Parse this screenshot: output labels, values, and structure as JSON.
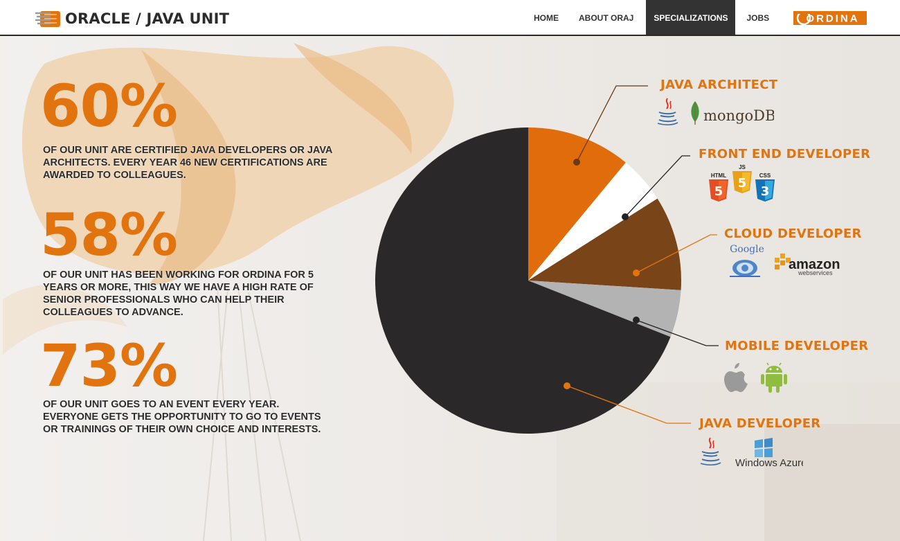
{
  "header": {
    "brand_title": "ORACLE / JAVA UNIT",
    "nav": [
      {
        "label": "HOME",
        "active": false
      },
      {
        "label": "ABOUT ORAJ",
        "active": false
      },
      {
        "label": "SPECIALIZATIONS",
        "active": true
      },
      {
        "label": "JOBS",
        "active": false
      }
    ],
    "partner_logo_text": "ORDINA"
  },
  "stats": [
    {
      "number": "60%",
      "text": "OF OUR UNIT ARE CERTIFIED JAVA DEVELOPERS OR JAVA ARCHITECTS. EVERY YEAR 46 NEW  CERTIFICATIONS ARE AWARDED TO COLLEAGUES."
    },
    {
      "number": "58%",
      "text": "OF OUR UNIT HAS BEEN WORKING FOR ORDINA FOR 5 YEARS OR MORE, THIS WAY WE HAVE A HIGH RATE OF SENIOR PROFESSIONALS WHO CAN HELP THEIR COLLEAGUES TO ADVANCE."
    },
    {
      "number": "73%",
      "text": "OF OUR UNIT GOES TO AN EVENT EVERY YEAR. EVERYONE GETS THE OPPORTUNITY TO GO TO EVENTS OR TRAININGS OF THEIR OWN CHOICE AND INTERESTS."
    }
  ],
  "roles": [
    {
      "title": "JAVA ARCHITECT",
      "tech": [
        "java-icon",
        "mongodb-logo"
      ],
      "tech_text": [
        "mongoDB"
      ]
    },
    {
      "title": "FRONT END DEVELOPER",
      "tech": [
        "html5-icon",
        "js-icon",
        "css3-icon"
      ],
      "tech_text": [
        "HTML",
        "JS",
        "CSS"
      ]
    },
    {
      "title": "CLOUD DEVELOPER",
      "tech": [
        "google-app-engine-logo",
        "amazon-web-services-logo"
      ],
      "tech_text": [
        "Google",
        "amazon",
        "webservices"
      ]
    },
    {
      "title": "MOBILE DEVELOPER",
      "tech": [
        "apple-icon",
        "android-icon"
      ],
      "tech_text": []
    },
    {
      "title": "JAVA DEVELOPER",
      "tech": [
        "java-icon",
        "windows-azure-logo"
      ],
      "tech_text": [
        "Windows Azure"
      ]
    }
  ],
  "chart_data": {
    "type": "pie",
    "slices": [
      {
        "label": "JAVA ARCHITECT",
        "value": 11,
        "color": "#e06c0c"
      },
      {
        "label": "FRONT END DEVELOPER",
        "value": 5,
        "color": "#ffffff"
      },
      {
        "label": "CLOUD DEVELOPER",
        "value": 10,
        "color": "#7a4419"
      },
      {
        "label": "MOBILE DEVELOPER",
        "value": 5,
        "color": "#b3b3b3"
      },
      {
        "label": "JAVA DEVELOPER",
        "value": 69,
        "color": "#2a2829"
      }
    ]
  },
  "colors": {
    "accent": "#e2740f",
    "dark": "#2a2829",
    "brown": "#7a4419"
  }
}
